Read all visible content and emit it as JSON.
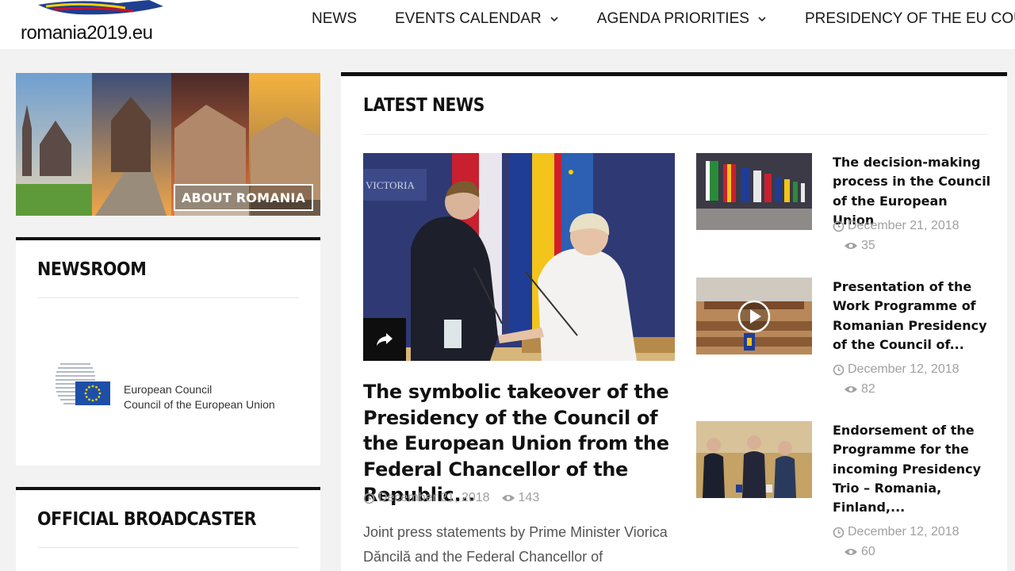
{
  "header": {
    "logo_text": "romania2019.eu",
    "nav": [
      {
        "label": "NEWS",
        "has_dropdown": false
      },
      {
        "label": "EVENTS CALENDAR",
        "has_dropdown": true
      },
      {
        "label": "AGENDA PRIORITIES",
        "has_dropdown": true
      },
      {
        "label": "PRESIDENCY OF THE EU COUNCIL",
        "has_dropdown": false
      }
    ]
  },
  "sidebar": {
    "about_label": "ABOUT ROMANIA",
    "newsroom_title": "NEWSROOM",
    "council_logo_line1": "European Council",
    "council_logo_line2": "Council of the European Union",
    "broadcaster_title": "OFFICIAL BROADCASTER"
  },
  "main": {
    "section_title": "LATEST NEWS",
    "feature": {
      "title": "The symbolic takeover of the Presidency of the Council of the European Union from the Federal Chancellor of the Republic...",
      "date": "December 21, 2018",
      "views": "143",
      "excerpt": " Joint press statements by Prime Minister Viorica Dăncilă and the Federal Chancellor of",
      "image_label": "VICTORIA"
    },
    "items": [
      {
        "title": "The decision-making process in the Council of the European Union",
        "date": "December 21, 2018",
        "views": "35",
        "has_video": false
      },
      {
        "title": "Presentation of the Work Programme of Romanian Presidency of the Council of...",
        "date": "December 12, 2018",
        "views": "82",
        "has_video": true
      },
      {
        "title": "Endorsement of the Programme for the incoming Presidency Trio – Romania, Finland,...",
        "date": "December 12, 2018",
        "views": "60",
        "has_video": false
      }
    ]
  },
  "colors": {
    "page_bg": "#f2f2f2",
    "header_bg": "#ffffff",
    "rule_dark": "#111111",
    "meta_grey": "#a0a0a0",
    "eu_blue": "#1d4fa8",
    "eu_yellow": "#f5d000"
  },
  "icons": [
    "chevron-down-icon",
    "share-icon",
    "clock-icon",
    "eye-icon",
    "play-icon",
    "eu-flag-icon"
  ]
}
